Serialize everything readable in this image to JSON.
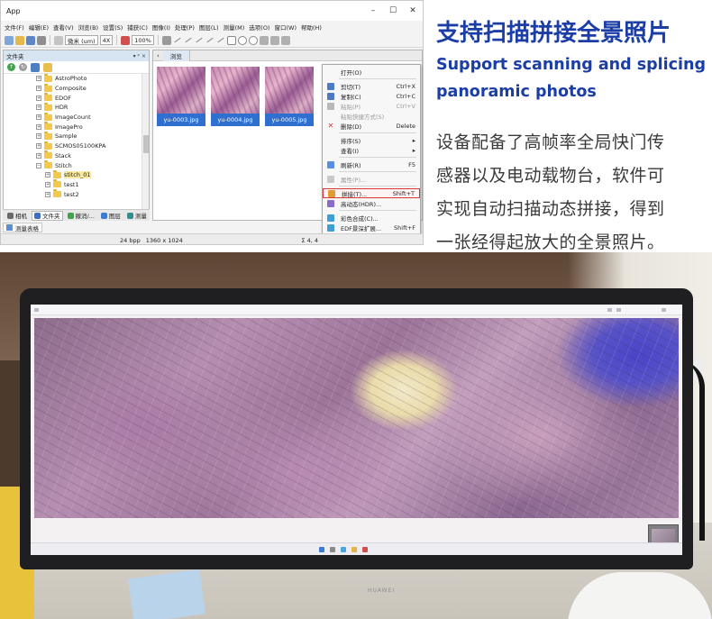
{
  "app": {
    "title": "App",
    "menu": [
      "文件(F)",
      "编辑(E)",
      "查看(V)",
      "浏览(B)",
      "设置(S)",
      "捕获(C)",
      "图像(I)",
      "处理(P)",
      "图层(L)",
      "测量(M)",
      "选项(O)",
      "窗口(W)",
      "帮助(H)"
    ],
    "toolbar": {
      "unit_select": "微米 (um)",
      "objective_select": "4X",
      "zoom_select": "100%"
    },
    "folder_panel": {
      "title": "文件夹",
      "tree": [
        "AstroPhoto",
        "Composite",
        "EDOF",
        "HDR",
        "ImageCount",
        "ImagePro",
        "Sample",
        "SCMOS05100KPA",
        "Stack",
        "Stitch"
      ],
      "stitch_children": [
        "stitch_01",
        "test1",
        "test2"
      ],
      "tabs": [
        "相机",
        "文件夹",
        "撤消/...",
        "图层",
        "测量"
      ]
    },
    "gallery": {
      "tab": "浏览",
      "thumbnails": [
        "yu-0003.jpg",
        "yu-0004.jpg",
        "yu-0005.jpg"
      ]
    },
    "context_menu": [
      {
        "label": "打开(O)",
        "shortcut": "",
        "disabled": false,
        "sep_after": true
      },
      {
        "label": "剪切(T)",
        "shortcut": "Ctrl+X",
        "disabled": false,
        "sep_after": false
      },
      {
        "label": "复制(C)",
        "shortcut": "Ctrl+C",
        "disabled": false,
        "sep_after": false
      },
      {
        "label": "粘贴(P)",
        "shortcut": "Ctrl+V",
        "disabled": true,
        "sep_after": false
      },
      {
        "label": "粘贴快捷方式(S)",
        "shortcut": "",
        "disabled": true,
        "sep_after": false
      },
      {
        "label": "删除(D)",
        "shortcut": "Delete",
        "disabled": false,
        "sep_after": true
      },
      {
        "label": "排序(S)",
        "shortcut": "▸",
        "disabled": false,
        "sep_after": false
      },
      {
        "label": "查看(I)",
        "shortcut": "▸",
        "disabled": false,
        "sep_after": true
      },
      {
        "label": "刷新(R)",
        "shortcut": "F5",
        "disabled": false,
        "sep_after": true
      },
      {
        "label": "属性(P)...",
        "shortcut": "",
        "disabled": true,
        "sep_after": true
      },
      {
        "label": "拼接(T)...",
        "shortcut": "Shift+T",
        "disabled": false,
        "sep_after": false,
        "highlighted": true
      },
      {
        "label": "高动态(HDR)...",
        "shortcut": "",
        "disabled": false,
        "sep_after": true
      },
      {
        "label": "彩色合成(C)...",
        "shortcut": "",
        "disabled": false,
        "sep_after": false
      },
      {
        "label": "EDF景深扩展...",
        "shortcut": "Shift+F",
        "disabled": false,
        "sep_after": false
      }
    ],
    "status": {
      "measure_tab": "测量表格",
      "bit_depth": "24 bpp",
      "resolution": "1360 x 1024",
      "sum": "Σ 4, 4"
    }
  },
  "promo": {
    "cn_title": "支持扫描拼接全景照片",
    "en_line1": "Support scanning and splicing",
    "en_line2": "panoramic photos",
    "desc_line1": "设备配备了高帧率全局快门传",
    "desc_line2": "感器以及电动载物台，软件可",
    "desc_line3": "实现自动扫描动态拼接，得到",
    "desc_line4": "一张经得起放大的全景照片。"
  },
  "photo": {
    "monitor_brand": "HUAWEI"
  },
  "colors": {
    "promo_blue": "#1b3ea6",
    "thumb_caption": "#2f6fcf",
    "highlight_red": "#d83a3a"
  }
}
